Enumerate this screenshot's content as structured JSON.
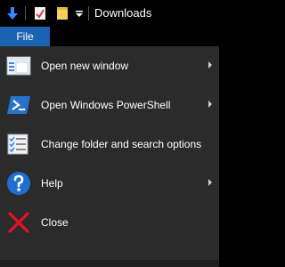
{
  "window": {
    "title": "Downloads"
  },
  "ribbon": {
    "file_tab": "File"
  },
  "menu": {
    "items": [
      {
        "label": "Open new window",
        "icon": "new-window-icon",
        "has_submenu": true
      },
      {
        "label": "Open Windows PowerShell",
        "icon": "powershell-icon",
        "has_submenu": true
      },
      {
        "label": "Change folder and search options",
        "icon": "folder-options-icon",
        "has_submenu": false
      },
      {
        "label": "Help",
        "icon": "help-icon",
        "has_submenu": true
      },
      {
        "label": "Close",
        "icon": "close-icon",
        "has_submenu": false
      }
    ]
  },
  "colors": {
    "accent": "#1a62b2",
    "menu_bg": "#2b2b2b",
    "titlebar_bg": "#000000",
    "close_red": "#e81123",
    "help_blue": "#1e6fd1"
  }
}
